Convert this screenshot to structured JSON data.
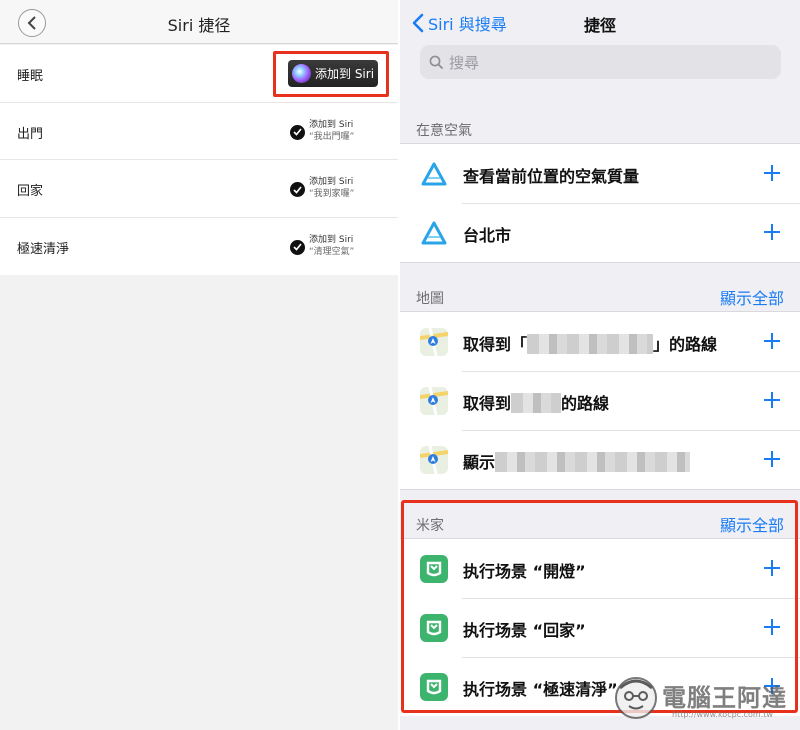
{
  "left": {
    "title": "Siri 捷径",
    "rows": [
      {
        "label": "睡眠",
        "button": "添加到 Siri"
      },
      {
        "label": "出門",
        "added": "添加到 Siri",
        "phrase": "“我出門囉”"
      },
      {
        "label": "回家",
        "added": "添加到 Siri",
        "phrase": "“我到家囉”"
      },
      {
        "label": "極速清淨",
        "added": "添加到 Siri",
        "phrase": "“清理空氣”"
      }
    ]
  },
  "right": {
    "back_label": "Siri 與搜尋",
    "title": "捷徑",
    "search_placeholder": "搜尋",
    "sections": [
      {
        "title": "在意空氣",
        "items": [
          "查看當前位置的空氣質量",
          "台北市"
        ]
      },
      {
        "title": "地圖",
        "show_all": "顯示全部",
        "items": [
          {
            "prefix": "取得到「",
            "suffix": "」的路線"
          },
          {
            "prefix": "取得到",
            "suffix": "的路線"
          },
          {
            "prefix": "顯示",
            "suffix": ""
          }
        ]
      },
      {
        "title": "米家",
        "show_all": "顯示全部",
        "items": [
          "执行场景 “開燈”",
          "执行场景 “回家”",
          "执行场景 “極速清淨”"
        ]
      }
    ]
  },
  "watermark": {
    "text": "電腦王阿達",
    "url": "http://www.kocpc.com.tw"
  },
  "colors": {
    "accent": "#1a7cf5",
    "highlight": "#e8311c",
    "mijia_green": "#3cb46e"
  }
}
